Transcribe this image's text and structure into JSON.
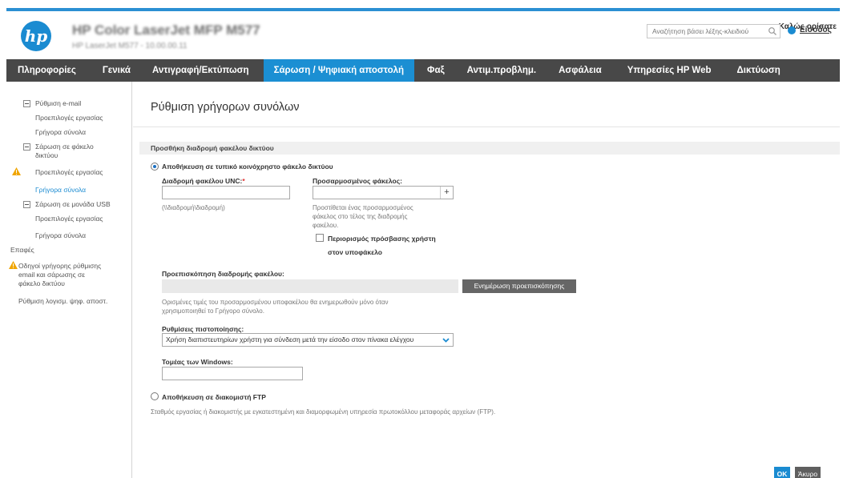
{
  "header": {
    "logo_text": "hp",
    "device_name": "HP Color LaserJet MFP M577",
    "device_sub": "HP LaserJet M577 - 10.00.00.11",
    "welcome": "Καλώς ορίσατε",
    "search_placeholder": "Αναζήτηση βάσει λέξης-κλειδιού",
    "signin_label": "Είσοδος"
  },
  "nav": {
    "tabs": [
      {
        "label": "Πληροφορίες"
      },
      {
        "label": "Γενικά"
      },
      {
        "label": "Αντιγραφή/Εκτύπωση"
      },
      {
        "label": "Σάρωση / Ψηφιακή αποστολή"
      },
      {
        "label": "Φαξ"
      },
      {
        "label": "Αντιμ.προβλημ."
      },
      {
        "label": "Ασφάλεια"
      },
      {
        "label": "Υπηρεσίες HP Web"
      },
      {
        "label": "Δικτύωση"
      }
    ],
    "active_index": 3
  },
  "sidebar": {
    "items": [
      {
        "label": "Ρύθμιση e-mail"
      },
      {
        "label": "Προεπιλογές εργασίας"
      },
      {
        "label": "Γρήγορα σύνολα"
      },
      {
        "label": "Σάρωση σε φάκελο"
      },
      {
        "label": "δικτύου"
      },
      {
        "label": "Προεπιλογές εργασίας"
      },
      {
        "label": "Γρήγορα σύνολα"
      },
      {
        "label": "Σάρωση σε μονάδα USB"
      },
      {
        "label": "Προεπιλογές εργασίας"
      },
      {
        "label": "Γρήγορα σύνολα"
      },
      {
        "label": "Επαφές"
      },
      {
        "label": "Οδηγοί γρήγορης ρύθμισης"
      },
      {
        "label": "email και σάρωσης σε"
      },
      {
        "label": "φάκελο δικτύου"
      },
      {
        "label": "Ρύθμιση λογισμ. ψηφ. αποστ."
      }
    ]
  },
  "main": {
    "page_title": "Ρύθμιση γρήγορων συνόλων",
    "section_title": "Προσθήκη διαδρομή φακέλου δικτύου",
    "radio_shared": "Αποθήκευση σε τυπικό κοινόχρηστο φάκελο δικτύου",
    "unc_label": "Διαδρομή φακέλου UNC:",
    "unc_required": "*",
    "unc_value": "",
    "unc_hint": "(\\\\διαδρομή\\διαδρομή)",
    "custom_label": "Προσαρμοσμένος φάκελος:",
    "custom_value": "",
    "custom_hint_1": "Προστίθεται ένας προσαρμοσμένος",
    "custom_hint_2": "φάκελος στο τέλος της διαδρομής",
    "custom_hint_3": "φακέλου.",
    "restrict_label_1": "Περιορισμός πρόσβασης χρήστη",
    "restrict_label_2": "στον υποφάκελο",
    "preview_label": "Προεπισκόπηση διαδρομής φακέλου:",
    "preview_button": "Ενημέρωση προεπισκόπησης",
    "preview_hint_1": "Ορισμένες τιμές του προσαρμοσμένου υποφακέλου θα ενημερωθούν μόνο όταν",
    "preview_hint_2": "χρησιμοποιηθεί το Γρήγορο σύνολο.",
    "auth_label": "Ρυθμίσεις πιστοποίησης:",
    "auth_value": "Χρήση διαπιστευτηρίων χρήστη για σύνδεση μετά την είσοδο στον πίνακα ελέγχου",
    "domain_label": "Τομέας των Windows:",
    "domain_value": "",
    "radio_ftp": "Αποθήκευση σε διακομιστή FTP",
    "ftp_hint": "Σταθμός εργασίας ή διακομιστής με εγκατεστημένη και διαμορφωμένη υπηρεσία πρωτοκόλλου μεταφοράς αρχείων (FTP).",
    "ok_button": "OK",
    "cancel_button": "Άκυρο"
  },
  "colors": {
    "accent": "#1b8fd3",
    "navbar": "#484848",
    "warning": "#f0a500"
  }
}
